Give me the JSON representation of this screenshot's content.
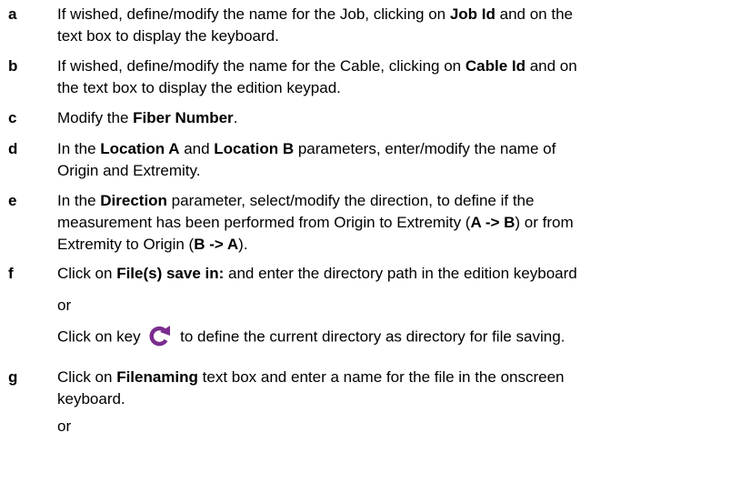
{
  "steps": [
    {
      "letter": "a",
      "lines": [
        [
          "If wished, define/modify the name for the Job, clicking on ",
          {
            "b": "Job Id"
          },
          " and on the"
        ],
        [
          "text box to display the keyboard."
        ]
      ]
    },
    {
      "letter": "b",
      "lines": [
        [
          "If wished, define/modify the name for the Cable, clicking on ",
          {
            "b": "Cable Id"
          },
          " and on"
        ],
        [
          "the text box to display the edition keypad."
        ]
      ]
    },
    {
      "letter": "c",
      "lines": [
        [
          "Modify the ",
          {
            "b": "Fiber Number"
          },
          "."
        ]
      ]
    },
    {
      "letter": "d",
      "lines": [
        [
          "In the ",
          {
            "b": "Location A"
          },
          " and ",
          {
            "b": "Location B"
          },
          " parameters, enter/modify the name of"
        ],
        [
          "Origin and Extremity."
        ]
      ]
    },
    {
      "letter": "e",
      "lines": [
        [
          "In the ",
          {
            "b": "Direction"
          },
          " parameter, select/modify the direction, to define if the"
        ],
        [
          "measurement has been performed from Origin to Extremity (",
          {
            "b": "A -> B"
          },
          ") or from"
        ],
        [
          "Extremity to Origin (",
          {
            "b": "B -> A"
          },
          ")."
        ]
      ]
    },
    {
      "letter": "f",
      "lines": [
        [
          "Click on ",
          {
            "b": "File(s) save in:"
          },
          " and enter the directory path in the edition keyboard"
        ],
        [
          "or"
        ],
        [
          "Click on key ",
          {
            "icon": "reload-icon"
          },
          " to define the current directory as directory for file saving."
        ]
      ]
    },
    {
      "letter": "g",
      "lines": [
        [
          "Click on ",
          {
            "b": "Filenaming"
          },
          " text box and enter a name for the file in the onscreen"
        ],
        [
          "keyboard."
        ],
        [
          "or"
        ]
      ]
    }
  ],
  "colors": {
    "text": "#000000",
    "icon": "#7b2d8e"
  }
}
